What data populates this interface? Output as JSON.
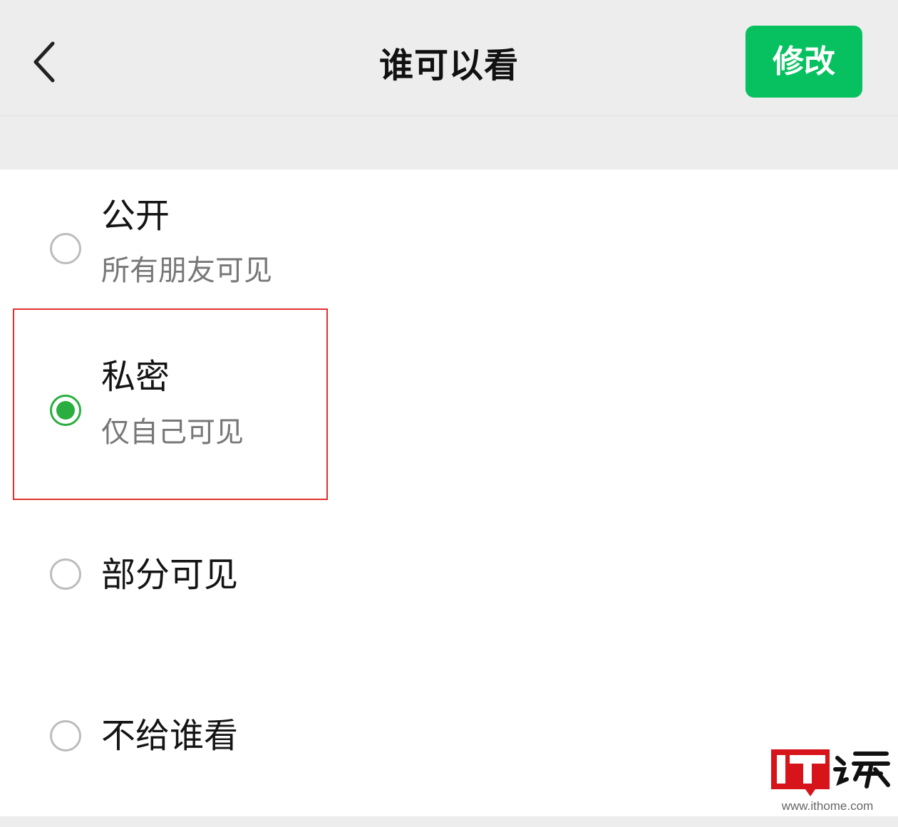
{
  "header": {
    "title": "谁可以看",
    "edit_label": "修改"
  },
  "options": [
    {
      "title": "公开",
      "subtitle": "所有朋友可见",
      "selected": false
    },
    {
      "title": "私密",
      "subtitle": "仅自己可见",
      "selected": true
    },
    {
      "title": "部分可见",
      "subtitle": "",
      "selected": false
    },
    {
      "title": "不给谁看",
      "subtitle": "",
      "selected": false
    }
  ],
  "watermark": {
    "brand": "IT之家",
    "url": "www.ithome.com"
  },
  "colors": {
    "accent": "#07c160",
    "radio_checked": "#2aae3f",
    "highlight": "#e03030"
  }
}
